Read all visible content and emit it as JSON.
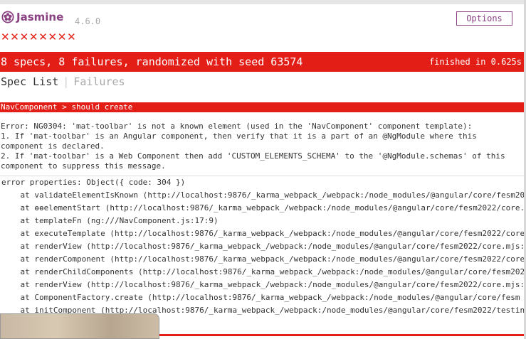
{
  "header": {
    "logo_text": "Jasmine",
    "logo_icon": "jasmine-flower-icon",
    "version": "4.6.0",
    "options_label": "Options"
  },
  "symbols": [
    "✕",
    "✕",
    "✕",
    "✕",
    "✕",
    "✕",
    "✕",
    "✕"
  ],
  "summary": {
    "text": "8 specs, 8 failures, randomized with seed 63574",
    "duration": "finished in 0.625s"
  },
  "menu": {
    "spec_list": "Spec List",
    "separator": "|",
    "failures": "Failures"
  },
  "failure": {
    "spec_name": "NavComponent > should create",
    "message": "Error: NG0304: 'mat-toolbar' is not a known element (used in the 'NavComponent' component template):\n1. If 'mat-toolbar' is an Angular component, then verify that it is a part of an @NgModule where this\ncomponent is declared.\n2. If 'mat-toolbar' is a Web Component then add 'CUSTOM_ELEMENTS_SCHEMA' to the '@NgModule.schemas' of this\ncomponent to suppress this message.",
    "stack": [
      "error properties: Object({ code: 304 })",
      "    at validateElementIsKnown (http://localhost:9876/_karma_webpack_/webpack:/node_modules/@angular/core/fesm20",
      "    at ɵɵelementStart (http://localhost:9876/_karma_webpack_/webpack:/node_modules/@angular/core/fesm2022/core.",
      "    at templateFn (ng:///NavComponent.js:17:9)",
      "    at executeTemplate (http://localhost:9876/_karma_webpack_/webpack:/node_modules/@angular/core/fesm2022/core",
      "    at renderView (http://localhost:9876/_karma_webpack_/webpack:/node_modules/@angular/core/fesm2022/core.mjs:",
      "    at renderComponent (http://localhost:9876/_karma_webpack_/webpack:/node_modules/@angular/core/fesm2022/core",
      "    at renderChildComponents (http://localhost:9876/_karma_webpack_/webpack:/node_modules/@angular/core/fesm202",
      "    at renderView (http://localhost:9876/_karma_webpack_/webpack:/node_modules/@angular/core/fesm2022/core.mjs:",
      "    at ComponentFactory.create (http://localhost:9876/_karma_webpack_/webpack:/node_modules/@angular/core/fesm",
      "    at initComponent (http://localhost:9876/_karma_webpack_/webpack:/node_modules/@angular/core/fesm2022/testin"
    ]
  },
  "colors": {
    "failure_red": "#e21e17",
    "brand_purple": "#8a4182",
    "muted_gray": "#a8a8a8"
  }
}
